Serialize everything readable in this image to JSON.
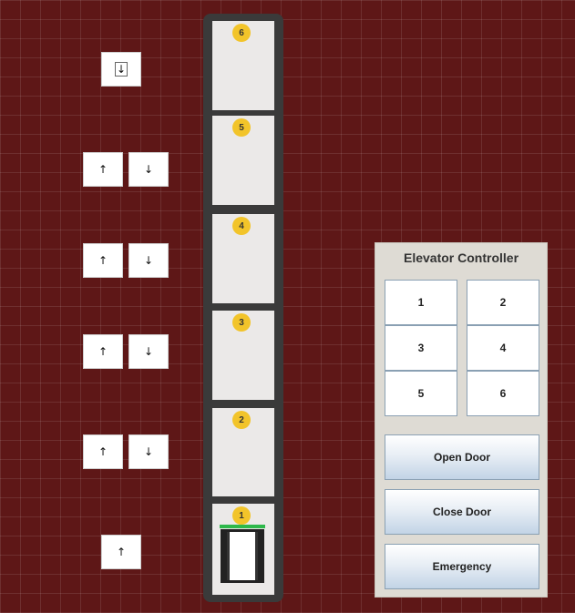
{
  "hall_calls": {
    "floor6": {
      "down": "↓"
    },
    "floor5": {
      "up": "↑",
      "down": "↓"
    },
    "floor4": {
      "up": "↑",
      "down": "↓"
    },
    "floor3": {
      "up": "↑",
      "down": "↓"
    },
    "floor2": {
      "up": "↑",
      "down": "↓"
    },
    "floor1": {
      "up": "↑"
    }
  },
  "shaft": {
    "floors": [
      "6",
      "5",
      "4",
      "3",
      "2",
      "1"
    ],
    "current_floor": "1",
    "indicator_color": "#2eb84a",
    "badge_color": "#f2c42a"
  },
  "controller": {
    "title": "Elevator Controller",
    "floor_buttons": [
      "1",
      "2",
      "3",
      "4",
      "5",
      "6"
    ],
    "open_door": "Open Door",
    "close_door": "Close Door",
    "emergency": "Emergency"
  }
}
